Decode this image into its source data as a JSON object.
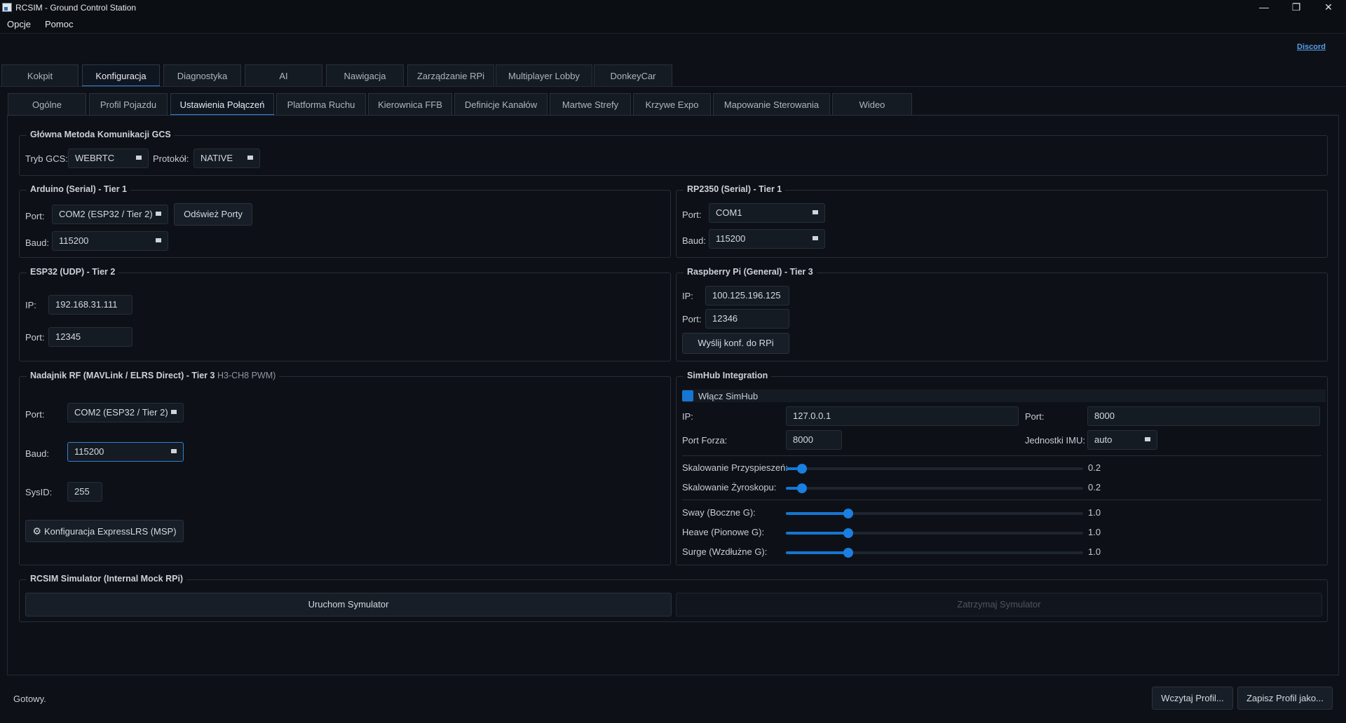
{
  "window": {
    "title": "RCSIM - Ground Control Station",
    "minimize": "—",
    "maximize": "❐",
    "close": "✕"
  },
  "menu": [
    "Opcje",
    "Pomoc"
  ],
  "discord_link": "Discord",
  "main_tabs": [
    {
      "label": "Kokpit",
      "active": false
    },
    {
      "label": "Konfiguracja",
      "active": true
    },
    {
      "label": "Diagnostyka",
      "active": false
    },
    {
      "label": "AI",
      "active": false
    },
    {
      "label": "Nawigacja",
      "active": false
    },
    {
      "label": "Zarządzanie RPi",
      "active": false
    },
    {
      "label": "Multiplayer Lobby",
      "active": false
    },
    {
      "label": "DonkeyCar",
      "active": false
    }
  ],
  "sub_tabs": [
    {
      "label": "Ogólne",
      "active": false
    },
    {
      "label": "Profil Pojazdu",
      "active": false
    },
    {
      "label": "Ustawienia Połączeń",
      "active": true
    },
    {
      "label": "Platforma Ruchu",
      "active": false
    },
    {
      "label": "Kierownica FFB",
      "active": false
    },
    {
      "label": "Definicje Kanałów",
      "active": false
    },
    {
      "label": "Martwe Strefy",
      "active": false
    },
    {
      "label": "Krzywe Expo",
      "active": false
    },
    {
      "label": "Mapowanie Sterowania",
      "active": false
    },
    {
      "label": "Wideo",
      "active": false
    }
  ],
  "gcs": {
    "title": "Główna Metoda Komunikacji GCS",
    "mode_label": "Tryb GCS:",
    "mode_value": "WEBRTC",
    "protocol_label": "Protokół:",
    "protocol_value": "NATIVE"
  },
  "arduino": {
    "title": "Arduino (Serial) - Tier 1",
    "port_label": "Port:",
    "port_value": "COM2 (ESP32 / Tier 2)",
    "refresh_button": "Odśwież Porty",
    "baud_label": "Baud:",
    "baud_value": "115200"
  },
  "rp2350": {
    "title": "RP2350 (Serial) - Tier 1",
    "port_label": "Port:",
    "port_value": "COM1",
    "baud_label": "Baud:",
    "baud_value": "115200"
  },
  "esp32": {
    "title": "ESP32 (UDP) - Tier 2",
    "ip_label": "IP:",
    "ip_value": "192.168.31.111",
    "port_label": "Port:",
    "port_value": "12345"
  },
  "rpi": {
    "title": "Raspberry Pi (General) - Tier 3",
    "ip_label": "IP:",
    "ip_value": "100.125.196.125",
    "port_label": "Port:",
    "port_value": "12346",
    "send_button": "Wyślij konf. do RPi"
  },
  "rf": {
    "title": "Nadajnik RF (MAVLink / ELRS Direct) - Tier 3",
    "title_overlap": "H3-CH8 PWM)",
    "port_label": "Port:",
    "port_value": "COM2 (ESP32 / Tier 2)",
    "baud_label": "Baud:",
    "baud_value": "115200",
    "sysid_label": "SysID:",
    "sysid_value": "255",
    "elrs_button": "Konfiguracja ExpressLRS (MSP)"
  },
  "simhub": {
    "title": "SimHub Integration",
    "enable_label": "Włącz SimHub",
    "enabled": true,
    "ip_label": "IP:",
    "ip_value": "127.0.0.1",
    "port_label": "Port:",
    "port_value": "8000",
    "force_port_label": "Port Forza:",
    "force_port_value": "8000",
    "imu_units_label": "Jednostki IMU:",
    "imu_units_value": "auto",
    "sliders": [
      {
        "label": "Skalowanie Przyspieszeń:",
        "value": "0.2",
        "fraction": 0.055
      },
      {
        "label": "Skalowanie Żyroskopu:",
        "value": "0.2",
        "fraction": 0.055
      },
      {
        "label": "Sway (Boczne G):",
        "value": "1.0",
        "fraction": 0.21
      },
      {
        "label": "Heave (Pionowe G):",
        "value": "1.0",
        "fraction": 0.21
      },
      {
        "label": "Surge (Wzdłużne G):",
        "value": "1.0",
        "fraction": 0.21
      }
    ]
  },
  "simulator": {
    "title": "RCSIM Simulator (Internal Mock RPi)",
    "start_button": "Uruchom Symulator",
    "stop_button": "Zatrzymaj Symulator"
  },
  "status": {
    "text": "Gotowy.",
    "load_button": "Wczytaj Profil...",
    "save_button": "Zapisz Profil jako..."
  }
}
